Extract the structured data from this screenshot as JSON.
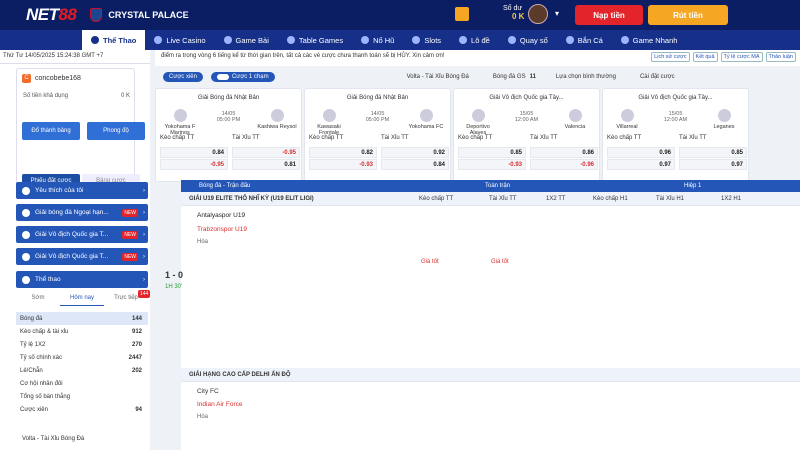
{
  "header": {
    "brand_a": "NET",
    "brand_b": "88",
    "club": "CRYSTAL PALACE",
    "balance_label": "Số dư",
    "balance_value": "0 K",
    "deposit": "Nạp tiền",
    "withdraw": "Rút tiền"
  },
  "nav": [
    "Thể Thao",
    "Live Casino",
    "Game Bài",
    "Table Games",
    "Nổ Hũ",
    "Slots",
    "Lô đề",
    "Quay số",
    "Bắn Cá",
    "Game Nhanh"
  ],
  "sidebar": {
    "datetime": "Thứ Tư 14/05/2025 15:24:38 GMT +7",
    "user": "concobebe168",
    "balance_label": "Số tiền khả dụng",
    "balance_value": "0 K",
    "btn1": "Đổ thành bảng",
    "btn2": "Phong độ",
    "tab1": "Phiếu đặt cược",
    "tab2": "Bảng cược",
    "items": [
      {
        "label": "Yêu thích của tôi"
      },
      {
        "label": "Giải bóng đá Ngoại hạn...",
        "badge": "NEW"
      },
      {
        "label": "Giải Vô địch Quốc gia T...",
        "badge": "NEW"
      },
      {
        "label": "Giải Vô địch Quốc gia T...",
        "badge": "NEW"
      },
      {
        "label": "Thể thao"
      }
    ],
    "tabs": [
      "Sớm",
      "Hôm nay",
      "Trực tiếp"
    ],
    "tab_count": "144",
    "list": [
      {
        "label": "Bóng đá",
        "n": "144"
      },
      {
        "label": "Kèo chấp & tài xỉu",
        "n": "912"
      },
      {
        "label": "Tỷ lệ 1X2",
        "n": "270"
      },
      {
        "label": "Tỷ số chính xác",
        "n": "2447"
      },
      {
        "label": "Lẻ/Chẵn",
        "n": "202"
      },
      {
        "label": "Cơ hội nhân đôi",
        "n": ""
      },
      {
        "label": "Tổng số bàn thắng",
        "n": ""
      },
      {
        "label": "Cược xiên",
        "n": "94"
      }
    ],
    "footer": "Volta - Tài Xỉu Bóng Đá"
  },
  "ticker": {
    "text": "điểm ra trong vòng 6 tiếng kể từ thời gian trên, tất cả các vé cược chưa thanh toán sẽ bị HỦY. Xin cảm ơn!",
    "tabs": [
      "Lịch sử cược",
      "Kết quả",
      "Tỷ lệ cược MA",
      "Thảo luận"
    ]
  },
  "filters": {
    "pill1": "Cược xiên",
    "pill2": "Cược 1 chạm",
    "volta": "Volta - Tài Xỉu Bóng Đá",
    "live": "Bóng đá GS",
    "count": "11",
    "sort": "Lựa chọn bình thường",
    "settings": "Cài đặt cược"
  },
  "cards": [
    {
      "league": "Giải Bóng đá Nhật Bản",
      "home": "Yokohama F Marinos",
      "away": "Kashiwa Reysol",
      "date": "14/05",
      "time": "05:00 PM",
      "rows": [
        [
          "0.84",
          "-0.95"
        ],
        [
          "-0.95",
          "0.81"
        ]
      ]
    },
    {
      "league": "Giải Bóng đá Nhật Bản",
      "home": "Kawasaki Frontale",
      "away": "Yokohama FC",
      "date": "14/05",
      "time": "05:00 PM",
      "rows": [
        [
          "0.82",
          "0.92"
        ],
        [
          "-0.93",
          "0.84"
        ]
      ]
    },
    {
      "league": "Giải Vô địch Quốc gia Tây...",
      "home": "Deportivo Alaves",
      "away": "Valencia",
      "date": "15/05",
      "time": "12:00 AM",
      "rows": [
        [
          "0.85",
          "0.86"
        ],
        [
          "-0.93",
          "-0.96"
        ]
      ]
    },
    {
      "league": "Giải Vô địch Quốc gia Tây...",
      "home": "Villarreal",
      "away": "Leganes",
      "date": "15/05",
      "time": "12:00 AM",
      "rows": [
        [
          "0.96",
          "0.85"
        ],
        [
          "0.97",
          "0.97"
        ]
      ]
    }
  ],
  "grid": {
    "section": "Bóng đá - Trận đấu",
    "toantran": "Toàn trận",
    "hiep1": "Hiệp 1",
    "cols": [
      "Kèo chấp TT",
      "Tài Xỉu TT",
      "1X2 TT",
      "Kèo chấp H1",
      "Tài Xỉu H1",
      "1X2 H1"
    ],
    "league1": "GIẢI U19 ELITE THỔ NHĨ KỲ (U19 ELIT LIGI)",
    "m1_home": "Antalyaspor U19",
    "m1_away": "Trabzonspor U19",
    "m1_draw": "Hòa",
    "score": "1 - 0",
    "minute": "1H 30'",
    "league2": "GIẢI HẠNG CAO CẤP DELHI ẤN ĐỘ",
    "m2_home": "City FC",
    "m2_away": "Indian Air Force",
    "m2_draw": "Hòa",
    "good": "Giá tốt"
  }
}
